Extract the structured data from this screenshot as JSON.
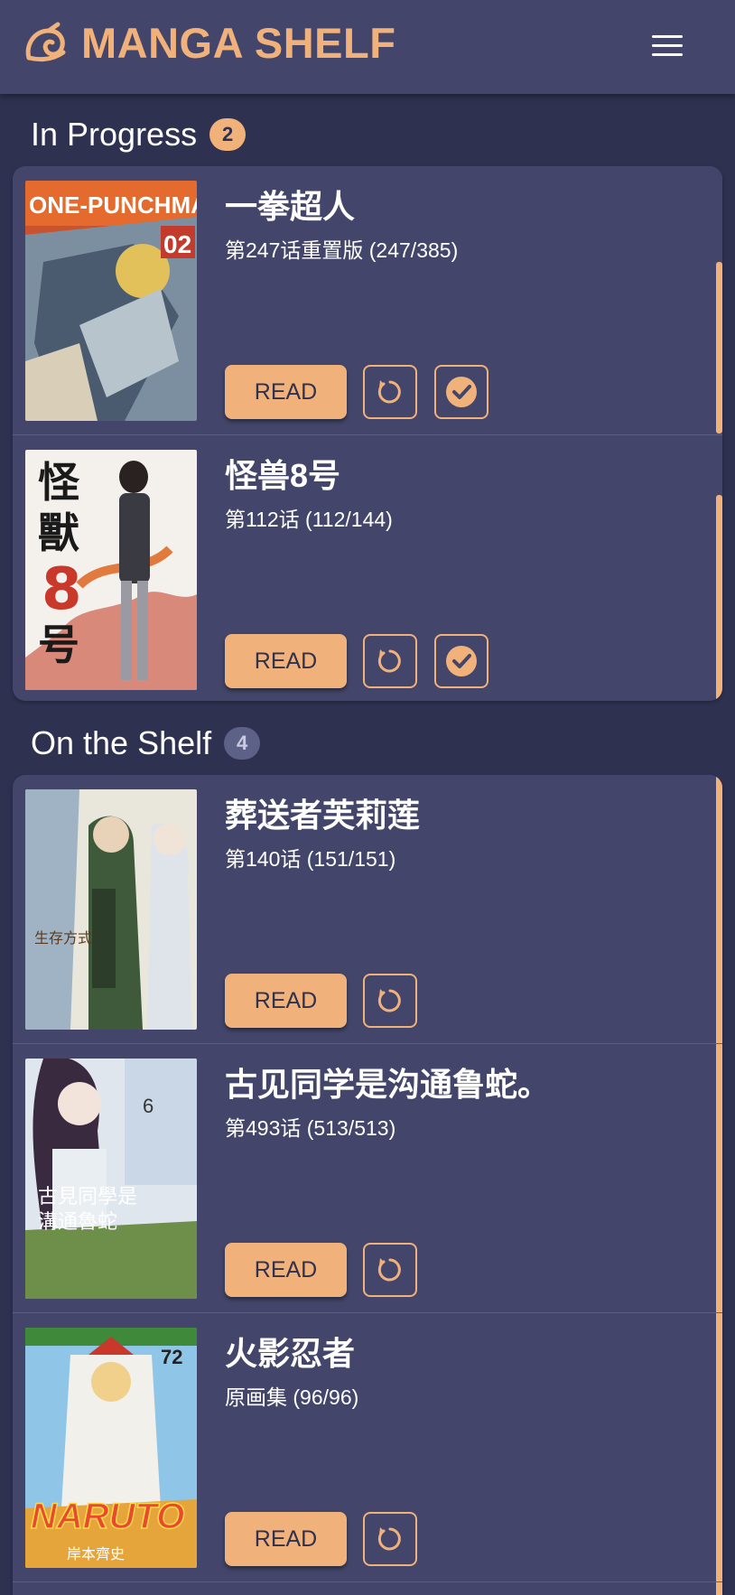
{
  "app": {
    "title": "MANGA SHELF",
    "logo_icon": "spiral-leaf-icon",
    "menu_icon": "hamburger-menu-icon",
    "accent_color": "#f0b27a",
    "background_color": "#2e3150",
    "card_color": "#43466a"
  },
  "in_progress": {
    "title": "In Progress",
    "count": "2",
    "items": [
      {
        "title": "一拳超人",
        "chapter": "第247话重置版 (247/385)",
        "read_label": "READ",
        "cover_icon": "manga-cover-one-punch-man"
      },
      {
        "title": "怪兽8号",
        "chapter": "第112话 (112/144)",
        "read_label": "READ",
        "cover_icon": "manga-cover-kaiju-no-8"
      }
    ]
  },
  "on_the_shelf": {
    "title": "On the Shelf",
    "count": "4",
    "items": [
      {
        "title": "葬送者芙莉莲",
        "chapter": "第140话 (151/151)",
        "read_label": "READ",
        "cover_icon": "manga-cover-frieren"
      },
      {
        "title": "古见同学是沟通鲁蛇。",
        "chapter": "第493话 (513/513)",
        "read_label": "READ",
        "cover_icon": "manga-cover-komi-san"
      },
      {
        "title": "火影忍者",
        "chapter": "原画集 (96/96)",
        "read_label": "READ",
        "cover_icon": "manga-cover-naruto"
      }
    ]
  },
  "cover_text": {
    "one_punch": "ONE-PUNCHMAN",
    "one_punch_vol": "02",
    "kaiju_line1": "怪",
    "kaiju_line2": "獸",
    "kaiju_line3": "8",
    "kaiju_line4": "号",
    "komi_line1": "古見同學是",
    "komi_line2": "溝通魯蛇",
    "komi_vol": "6",
    "naruto": "NARUTO",
    "naruto_vol": "72",
    "naruto_author": "岸本齊史"
  }
}
